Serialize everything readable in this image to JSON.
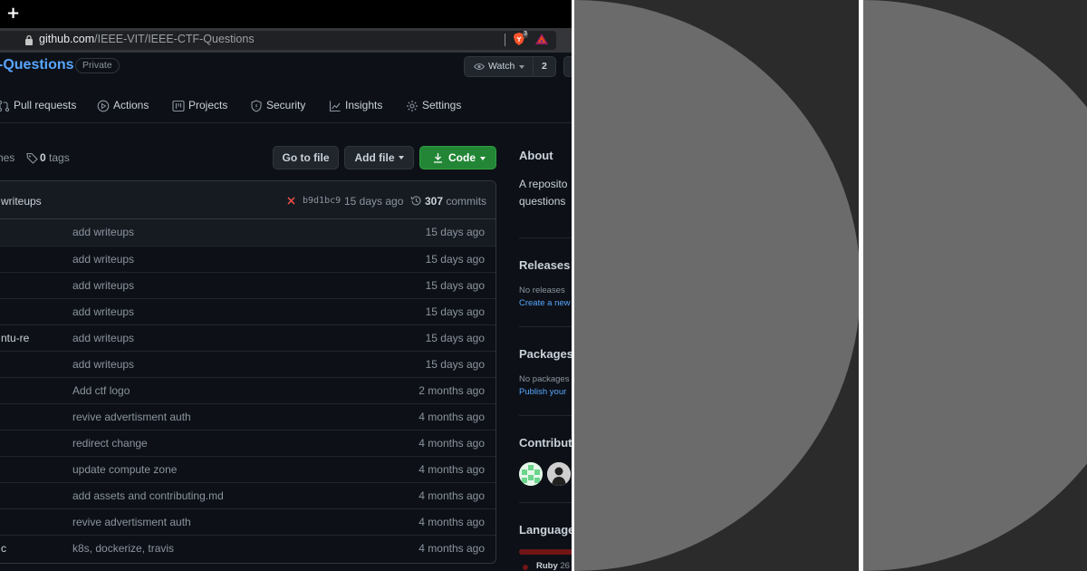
{
  "browser": {
    "new_tab_glyph": "+",
    "url_host": "github.com",
    "url_path": "/IEEE-VIT/IEEE-CTF-Questions",
    "brave_shield_count": "3",
    "icons": [
      "lock-icon",
      "brave-shield-icon",
      "brave-rewards-icon"
    ]
  },
  "repo": {
    "name": "-Questions",
    "visibility": "Private",
    "watch_label": "Watch",
    "watch_count": "2"
  },
  "tabs": [
    {
      "label": "Pull requests",
      "icon": "pull-request-icon"
    },
    {
      "label": "Actions",
      "icon": "play-icon"
    },
    {
      "label": "Projects",
      "icon": "project-icon"
    },
    {
      "label": "Security",
      "icon": "shield-icon"
    },
    {
      "label": "Insights",
      "icon": "graph-icon"
    },
    {
      "label": "Settings",
      "icon": "gear-icon"
    }
  ],
  "toolbar": {
    "branches_fragment": "hes",
    "tags_count": "0",
    "tags_label": "tags",
    "go_to_file": "Go to file",
    "add_file": "Add file",
    "code": "Code"
  },
  "latest_commit": {
    "message": "writeups",
    "sha": "b9d1bc9",
    "time": "15 days ago",
    "commits_count": "307",
    "commits_label": "commits"
  },
  "files": [
    {
      "name": "",
      "message": "add writeups",
      "time": "15 days ago"
    },
    {
      "name": "",
      "message": "add writeups",
      "time": "15 days ago"
    },
    {
      "name": "",
      "message": "add writeups",
      "time": "15 days ago"
    },
    {
      "name": "",
      "message": "add writeups",
      "time": "15 days ago"
    },
    {
      "name": "ntu-re",
      "message": "add writeups",
      "time": "15 days ago"
    },
    {
      "name": "",
      "message": "add writeups",
      "time": "15 days ago"
    },
    {
      "name": "",
      "message": "Add ctf logo",
      "time": "2 months ago"
    },
    {
      "name": "",
      "message": "revive advertisment auth",
      "time": "4 months ago"
    },
    {
      "name": "",
      "message": "redirect change",
      "time": "4 months ago"
    },
    {
      "name": "",
      "message": "update compute zone",
      "time": "4 months ago"
    },
    {
      "name": "",
      "message": "add assets and contributing.md",
      "time": "4 months ago"
    },
    {
      "name": "",
      "message": "revive advertisment auth",
      "time": "4 months ago"
    },
    {
      "name": "c",
      "message": "k8s, dockerize, travis",
      "time": "4 months ago"
    }
  ],
  "sidebar": {
    "about_title": "About",
    "about_line1": "A reposito",
    "about_line2": "questions",
    "releases_title": "Releases",
    "releases_none": "No releases",
    "releases_link": "Create a new",
    "packages_title": "Packages",
    "packages_none": "No packages",
    "packages_link": "Publish your",
    "contributors_title": "Contribut",
    "languages_title": "Language",
    "language_name": "Ruby",
    "language_pct": "26",
    "language_color": "#701516"
  },
  "colors": {
    "bg": "#0d1117",
    "link": "#58a6ff",
    "primary_button": "#238636",
    "deco_circle": "#6b6b6b",
    "deco_bg": "#2b2b2b"
  }
}
